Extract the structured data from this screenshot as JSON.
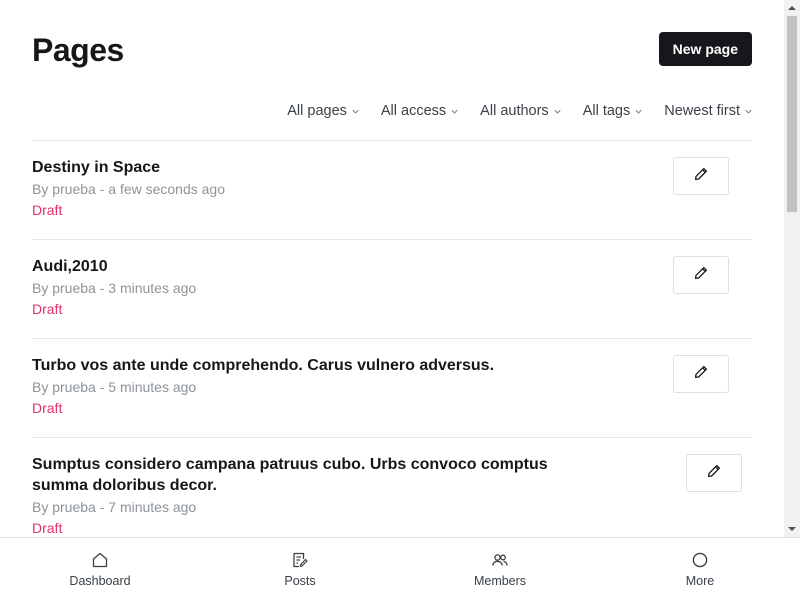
{
  "header": {
    "title": "Pages",
    "new_page_label": "New page"
  },
  "filters": [
    {
      "label": "All pages"
    },
    {
      "label": "All access"
    },
    {
      "label": "All authors"
    },
    {
      "label": "All tags"
    },
    {
      "label": "Newest first"
    }
  ],
  "pages": [
    {
      "title": "Destiny in Space",
      "meta": "By prueba - a few seconds ago",
      "status": "Draft"
    },
    {
      "title": "Audi,2010",
      "meta": "By prueba - 3 minutes ago",
      "status": "Draft"
    },
    {
      "title": "Turbo vos ante unde comprehendo. Carus vulnero adversus.",
      "meta": "By prueba - 5 minutes ago",
      "status": "Draft"
    },
    {
      "title": "Sumptus considero campana patruus cubo. Urbs convoco comptus summa doloribus decor.",
      "meta": "By prueba - 7 minutes ago",
      "status": "Draft"
    }
  ],
  "nav": [
    {
      "label": "Dashboard",
      "icon": "home-icon"
    },
    {
      "label": "Posts",
      "icon": "posts-icon"
    },
    {
      "label": "Members",
      "icon": "members-icon"
    },
    {
      "label": "More",
      "icon": "more-icon"
    }
  ],
  "colors": {
    "accent_dark": "#15171a",
    "draft_status": "#e0306d",
    "meta_text": "#8e9499"
  }
}
